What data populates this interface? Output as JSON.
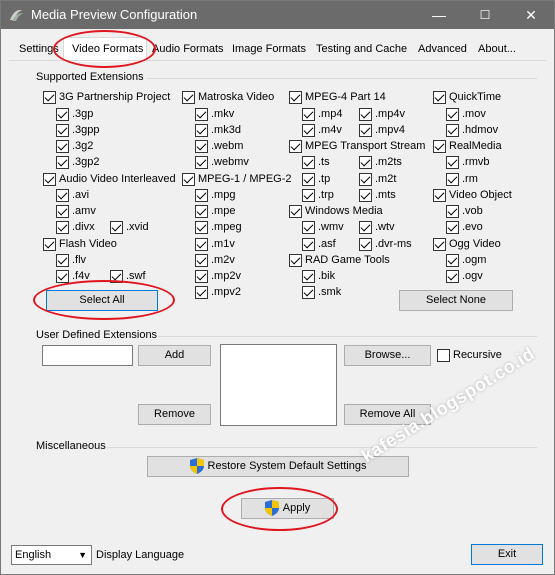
{
  "window": {
    "title": "Media Preview Configuration",
    "minimize": "—",
    "maximize": "☐",
    "close": "✕"
  },
  "tabs": [
    {
      "label": "Settings"
    },
    {
      "label": "Video Formats",
      "active": true
    },
    {
      "label": "Audio Formats"
    },
    {
      "label": "Image Formats"
    },
    {
      "label": "Testing and Cache"
    },
    {
      "label": "Advanced"
    },
    {
      "label": "About..."
    }
  ],
  "supported": {
    "heading": "Supported Extensions",
    "col1": [
      {
        "label": "3G Partnership Project",
        "checked": true
      },
      {
        "label": ".3gp",
        "checked": true
      },
      {
        "label": ".3gpp",
        "checked": true
      },
      {
        "label": ".3g2",
        "checked": true
      },
      {
        "label": ".3gp2",
        "checked": true
      },
      {
        "label": "Audio Video Interleaved",
        "checked": true
      },
      {
        "label": ".avi",
        "checked": true
      },
      {
        "label": ".amv",
        "checked": true
      },
      {
        "label": ".divx",
        "checked": true
      },
      {
        "label": ".xvid",
        "checked": true
      },
      {
        "label": "Flash Video",
        "checked": true
      },
      {
        "label": ".flv",
        "checked": true
      },
      {
        "label": ".f4v",
        "checked": true
      },
      {
        "label": ".swf",
        "checked": true
      }
    ],
    "col2": [
      {
        "label": "Matroska Video",
        "checked": true
      },
      {
        "label": ".mkv",
        "checked": true
      },
      {
        "label": ".mk3d",
        "checked": true
      },
      {
        "label": ".webm",
        "checked": true
      },
      {
        "label": ".webmv",
        "checked": true
      },
      {
        "label": "MPEG-1 / MPEG-2",
        "checked": true
      },
      {
        "label": ".mpg",
        "checked": true
      },
      {
        "label": ".mpe",
        "checked": true
      },
      {
        "label": ".mpeg",
        "checked": true
      },
      {
        "label": ".m1v",
        "checked": true
      },
      {
        "label": ".m2v",
        "checked": true
      },
      {
        "label": ".mp2v",
        "checked": true
      },
      {
        "label": ".mpv2",
        "checked": true
      }
    ],
    "col3": [
      {
        "label": "MPEG-4 Part 14",
        "checked": true
      },
      {
        "label": ".mp4",
        "checked": true
      },
      {
        "label": ".mp4v",
        "checked": true
      },
      {
        "label": ".m4v",
        "checked": true
      },
      {
        "label": ".mpv4",
        "checked": true
      },
      {
        "label": "MPEG Transport Stream",
        "checked": true
      },
      {
        "label": ".ts",
        "checked": true
      },
      {
        "label": ".m2ts",
        "checked": true
      },
      {
        "label": ".tp",
        "checked": true
      },
      {
        "label": ".m2t",
        "checked": true
      },
      {
        "label": ".trp",
        "checked": true
      },
      {
        "label": ".mts",
        "checked": true
      },
      {
        "label": "Windows Media",
        "checked": true
      },
      {
        "label": ".wmv",
        "checked": true
      },
      {
        "label": ".wtv",
        "checked": true
      },
      {
        "label": ".asf",
        "checked": true
      },
      {
        "label": ".dvr-ms",
        "checked": true
      },
      {
        "label": "RAD Game Tools",
        "checked": true
      },
      {
        "label": ".bik",
        "checked": true
      },
      {
        "label": ".smk",
        "checked": true
      }
    ],
    "col4": [
      {
        "label": "QuickTime",
        "checked": true
      },
      {
        "label": ".mov",
        "checked": true
      },
      {
        "label": ".hdmov",
        "checked": true
      },
      {
        "label": "RealMedia",
        "checked": true
      },
      {
        "label": ".rmvb",
        "checked": true
      },
      {
        "label": ".rm",
        "checked": true
      },
      {
        "label": "Video Object",
        "checked": true
      },
      {
        "label": ".vob",
        "checked": true
      },
      {
        "label": ".evo",
        "checked": true
      },
      {
        "label": "Ogg Video",
        "checked": true
      },
      {
        "label": ".ogm",
        "checked": true
      },
      {
        "label": ".ogv",
        "checked": true
      }
    ],
    "select_all": "Select All",
    "select_none": "Select None"
  },
  "user_defined": {
    "heading": "User Defined Extensions",
    "input_value": "",
    "add": "Add",
    "remove": "Remove",
    "browse": "Browse...",
    "recursive": "Recursive",
    "recursive_checked": false,
    "remove_all": "Remove All"
  },
  "misc": {
    "heading": "Miscellaneous",
    "restore": "Restore System Default Settings"
  },
  "apply": "Apply",
  "footer": {
    "language": "English",
    "language_label": "Display Language",
    "exit": "Exit"
  },
  "watermark": "kafesia.blogspot.co.id",
  "colors": {
    "highlight": "#e0161f",
    "titlebar": "#6b6b6b",
    "focus": "#0078d7"
  }
}
